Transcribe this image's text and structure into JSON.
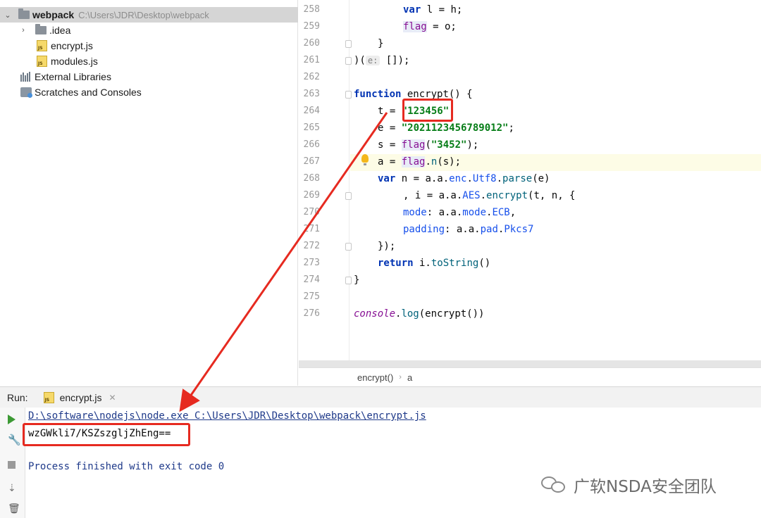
{
  "project": {
    "root": {
      "name": "webpack",
      "path": "C:\\Users\\JDR\\Desktop\\webpack"
    },
    "items": [
      {
        "label": ".idea"
      },
      {
        "label": "encrypt.js"
      },
      {
        "label": "modules.js"
      },
      {
        "label": "External Libraries"
      },
      {
        "label": "Scratches and Consoles"
      }
    ]
  },
  "editor": {
    "line_numbers": [
      "258",
      "259",
      "260",
      "261",
      "262",
      "263",
      "264",
      "265",
      "266",
      "267",
      "268",
      "269",
      "270",
      "271",
      "272",
      "273",
      "274",
      "275",
      "276"
    ],
    "code": {
      "l258_kw": "var",
      "l258_rest": " l = h;",
      "l259_flag": "flag",
      "l259_rest": " = o;",
      "l260": "}",
      "l261_a": ")(",
      "l261_hint": "e:",
      "l261_b": " []);",
      "l263_kw": "function",
      "l263_rest": " encrypt() {",
      "l264_a": "t = ",
      "l264_str": "\"123456\"",
      "l264_b": ";",
      "l265_a": "e = ",
      "l265_str": "\"2021123456789012\"",
      "l265_b": ";",
      "l266_a": "s = ",
      "l266_flag": "flag",
      "l266_b": "(",
      "l266_str": "\"3452\"",
      "l266_c": ");",
      "l267_a": "a = ",
      "l267_flag": "flag",
      "l267_b": ".",
      "l267_n": "n",
      "l267_c": "(s);",
      "l268_kw": "var",
      "l268_a": " n = a.a.",
      "l268_p1": "enc",
      "l268_b": ".",
      "l268_p2": "Utf8",
      "l268_c": ".",
      "l268_fn": "parse",
      "l268_d": "(e)",
      "l269_a": ", i = a.a.",
      "l269_p1": "AES",
      "l269_b": ".",
      "l269_fn": "encrypt",
      "l269_c": "(t, n, {",
      "l270_p": "mode",
      "l270_a": ": a.a.",
      "l270_p2": "mode",
      "l270_b": ".",
      "l270_p3": "ECB",
      "l270_c": ",",
      "l271_p": "padding",
      "l271_a": ": a.a.",
      "l271_p2": "pad",
      "l271_b": ".",
      "l271_p3": "Pkcs7",
      "l272": "});",
      "l273_kw": "return",
      "l273_a": " i.",
      "l273_fn": "toString",
      "l273_b": "()",
      "l274": "}",
      "l276_obj": "console",
      "l276_a": ".",
      "l276_fn": "log",
      "l276_b": "(encrypt())"
    },
    "breadcrumb": [
      "encrypt()",
      "a"
    ]
  },
  "run": {
    "label": "Run:",
    "tab": "encrypt.js",
    "command": "D:\\software\\nodejs\\node.exe C:\\Users\\JDR\\Desktop\\webpack\\encrypt.js",
    "output": "wzGWkli7/KSZszgljZhEng==",
    "exit": "Process finished with exit code 0"
  },
  "watermark": "广软NSDA安全团队",
  "colors": {
    "annotation": "#e62a20",
    "keyword": "#0033b3",
    "string": "#067d17"
  }
}
